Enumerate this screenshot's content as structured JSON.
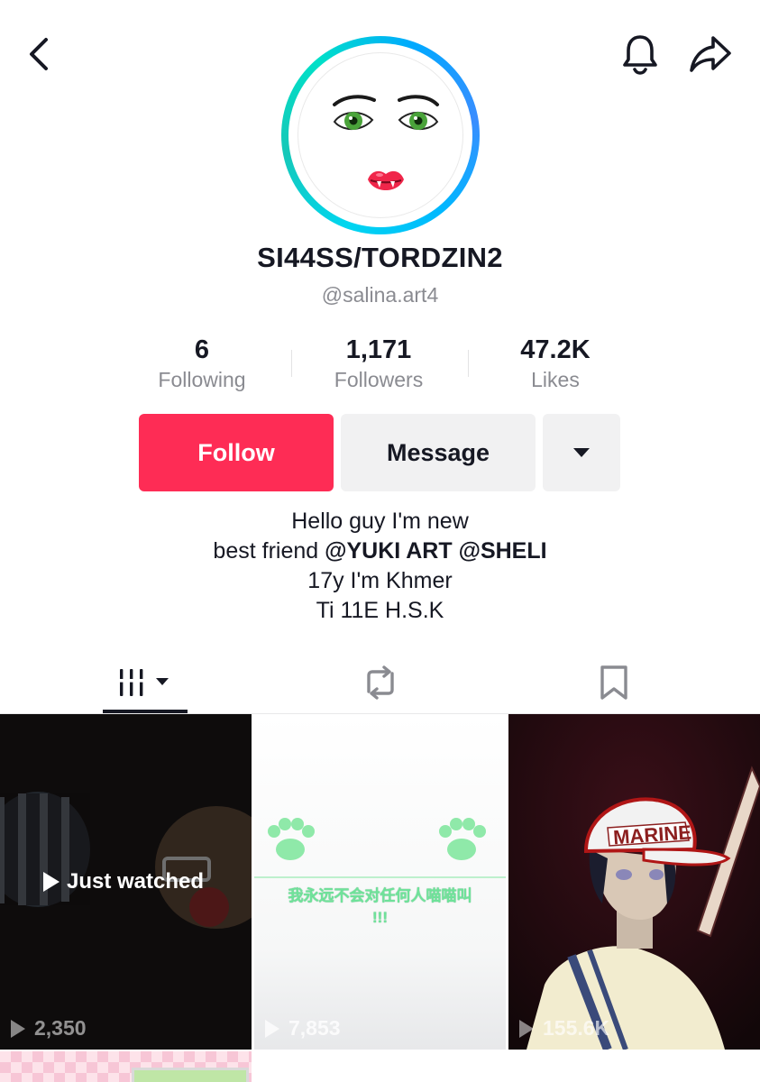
{
  "profile": {
    "display_name": "SI44SS/TORDZIN2",
    "handle": "@salina.art4",
    "avatar_icon": "cartoon-face-avatar",
    "avatar_ring_colors": [
      "#00d6f0",
      "#3a8dff",
      "#16c8b8"
    ]
  },
  "stats": [
    {
      "value": "6",
      "label": "Following"
    },
    {
      "value": "1,171",
      "label": "Followers"
    },
    {
      "value": "47.2K",
      "label": "Likes"
    }
  ],
  "actions": {
    "follow_label": "Follow",
    "message_label": "Message",
    "follow_color": "#fe2c55"
  },
  "bio": {
    "line1": "Hello guy I'm new",
    "line2_prefix": "best friend ",
    "mention1": "@YUKI ART",
    "mention2": "@SHELI",
    "line3": "17y I'm Khmer",
    "line4": "Ti 11E H.S.K"
  },
  "tabs": [
    {
      "name": "videos",
      "icon": "grid-columns-icon",
      "active": true
    },
    {
      "name": "reposts",
      "icon": "repost-icon",
      "active": false
    },
    {
      "name": "saved",
      "icon": "bookmark-icon",
      "active": false
    }
  ],
  "videos": [
    {
      "views": "2,350",
      "badge": "Just watched"
    },
    {
      "views": "7,853",
      "caption_line1": "我永远不会对任何人喵喵叫",
      "caption_line2": "!!!"
    },
    {
      "views": "155.6K",
      "cap_text": "MARINE"
    }
  ],
  "icons": {
    "back": "chevron-left-icon",
    "notifications": "bell-icon",
    "share": "share-arrow-icon",
    "more": "caret-down-icon"
  }
}
